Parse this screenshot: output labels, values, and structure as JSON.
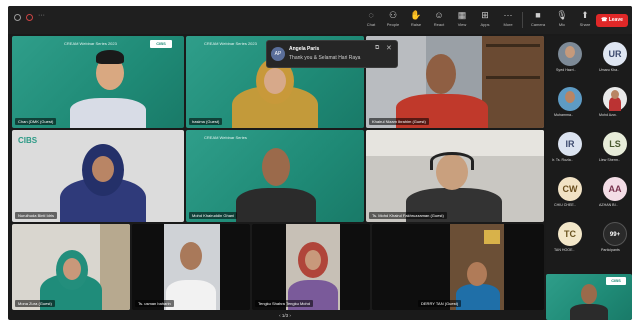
{
  "toolbar": {
    "chat": "Chat",
    "people": "People",
    "raise": "Raise",
    "react": "React",
    "view": "View",
    "apps": "Apps",
    "more": "More",
    "camera": "Camera",
    "mic": "Mic",
    "share": "Share",
    "leave": "Leave"
  },
  "chat_popup": {
    "avatar": "AP",
    "sender": "Angela Paris",
    "message": "Thank you & Selamat Hari Raya"
  },
  "banner": {
    "series": "CREAM Webinar Series 2023",
    "series_short": "CREAM Webinar Series",
    "logo": "CIBS"
  },
  "tiles": [
    {
      "name": "Chan (DMK (Guest)"
    },
    {
      "name": "hasima (Guest)"
    },
    {
      "name": "Khairul Nizam Ibrahim (Guest)"
    },
    {
      "name": "Nurulhuda Binti Idris"
    },
    {
      "name": "Mohd Khairuddin Ghani"
    },
    {
      "name": "Ts. Mohd Khairul Fakhruzzaman (Guest)"
    },
    {
      "name": "Mona Zura (Guest)"
    },
    {
      "name": "Ts. usman baharin"
    },
    {
      "name": "Tengku Shahra Tengku Mohd"
    },
    {
      "name": "DERRY TAN (Guest)"
    }
  ],
  "roster": [
    {
      "name": "Syed Hazri..",
      "initials": ""
    },
    {
      "name": "Umaru Kha..",
      "initials": "UR"
    },
    {
      "name": "Muhamma..",
      "initials": ""
    },
    {
      "name": "Mohd Azw..",
      "initials": ""
    },
    {
      "name": "Ir. Ts. Rozia..",
      "initials": "IR"
    },
    {
      "name": "Liew Sherm..",
      "initials": "LS"
    },
    {
      "name": "CHIU CHEE..",
      "initials": "CW"
    },
    {
      "name": "AZHAN BI..",
      "initials": "AA"
    },
    {
      "name": "TAN HOOE..",
      "initials": "TC"
    },
    {
      "name": "Participants",
      "initials": "99+"
    }
  ],
  "pager": {
    "text": "1/3"
  },
  "self_view": {
    "label": "CIBS"
  }
}
